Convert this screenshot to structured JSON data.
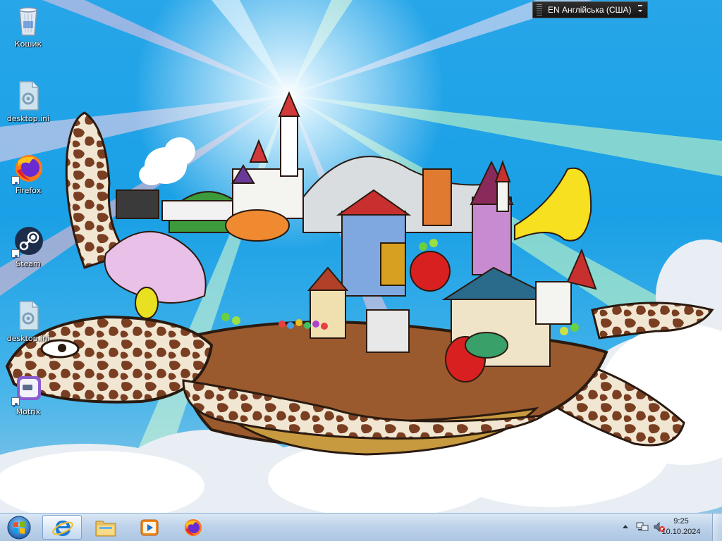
{
  "desktop": {
    "icons": [
      {
        "label": "Кошик",
        "icon": "recycle-bin-icon"
      },
      {
        "label": "desktop.ini",
        "icon": "settings-file-icon"
      },
      {
        "label": "Firefox",
        "icon": "firefox-icon"
      },
      {
        "label": "Steam",
        "icon": "steam-icon"
      },
      {
        "label": "desktop.ini",
        "icon": "settings-file-icon"
      },
      {
        "label": "Motrix",
        "icon": "motrix-icon"
      }
    ]
  },
  "language_bar": {
    "text": "EN Англійська (США)"
  },
  "taskbar": {
    "pinned": [
      {
        "name": "Internet Explorer",
        "icon": "internet-explorer-icon",
        "active": true
      },
      {
        "name": "File Explorer",
        "icon": "file-explorer-icon",
        "active": false
      },
      {
        "name": "Windows Media Player",
        "icon": "media-player-icon",
        "active": false
      },
      {
        "name": "Firefox",
        "icon": "firefox-icon",
        "active": false
      }
    ],
    "clock": {
      "time": "9:25",
      "date": "10.10.2024"
    }
  },
  "colors": {
    "sky": "#1aa0e6",
    "taskbar": "#bfd3ea",
    "turtle_shell": "#8a4a2a",
    "turtle_spots": "#6b3a1e"
  }
}
